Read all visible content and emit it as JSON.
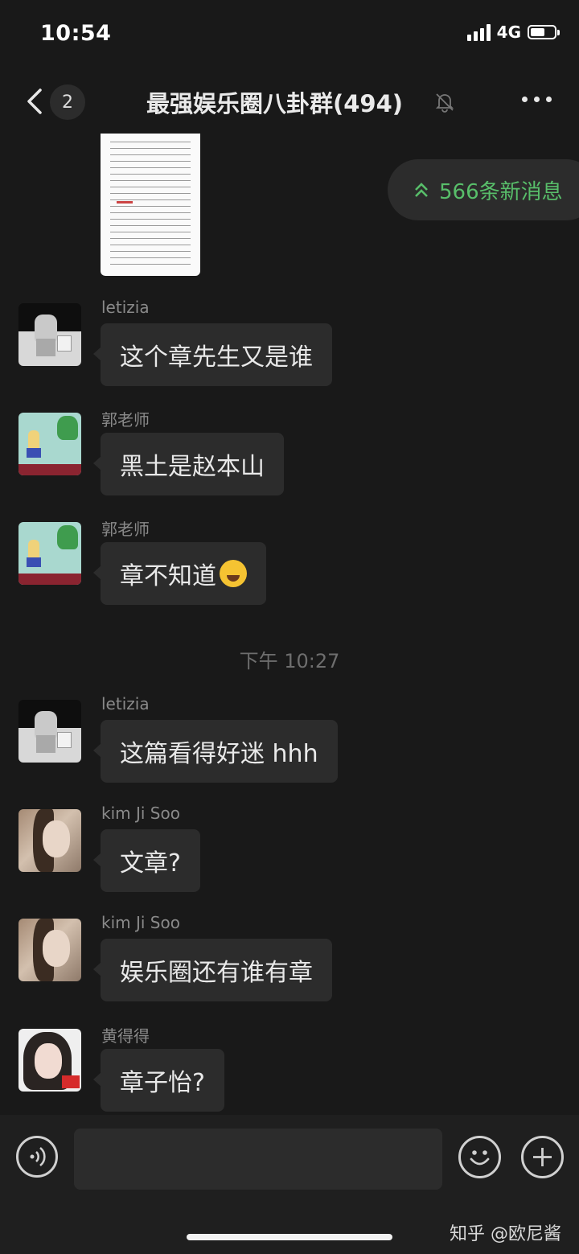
{
  "status_bar": {
    "time": "10:54",
    "network": "4G",
    "battery_level": 0.6
  },
  "header": {
    "title": "最强娱乐圈八卦群(494)",
    "unread_count": "2",
    "muted": true
  },
  "new_messages_pill": {
    "text": "566条新消息"
  },
  "time_divider": "下午 10:27",
  "messages": [
    {
      "sender": "letizia",
      "text": "这个章先生又是谁",
      "avatar": "astronaut-avatar"
    },
    {
      "sender": "郭老师",
      "text": "黑土是赵本山",
      "avatar": "pixel-dino-avatar"
    },
    {
      "sender": "郭老师",
      "text": "章不知道",
      "avatar": "pixel-dino-avatar",
      "emoji": "facepalm-emoji"
    },
    {
      "sender": "letizia",
      "text": "这篇看得好迷 hhh",
      "avatar": "astronaut-avatar"
    },
    {
      "sender": "kim Ji Soo",
      "text": "文章?",
      "avatar": "portrait-avatar"
    },
    {
      "sender": "kim Ji Soo",
      "text": "娱乐圈还有谁有章",
      "avatar": "portrait-avatar"
    },
    {
      "sender": "黄得得",
      "text": "章子怡?",
      "avatar": "portrait-flag-avatar"
    }
  ],
  "input_bar": {
    "placeholder": "",
    "value": ""
  },
  "watermark": "知乎 @欧尼酱",
  "colors": {
    "background": "#191919",
    "bubble": "#2c2c2c",
    "accent_green": "#58be6a"
  }
}
